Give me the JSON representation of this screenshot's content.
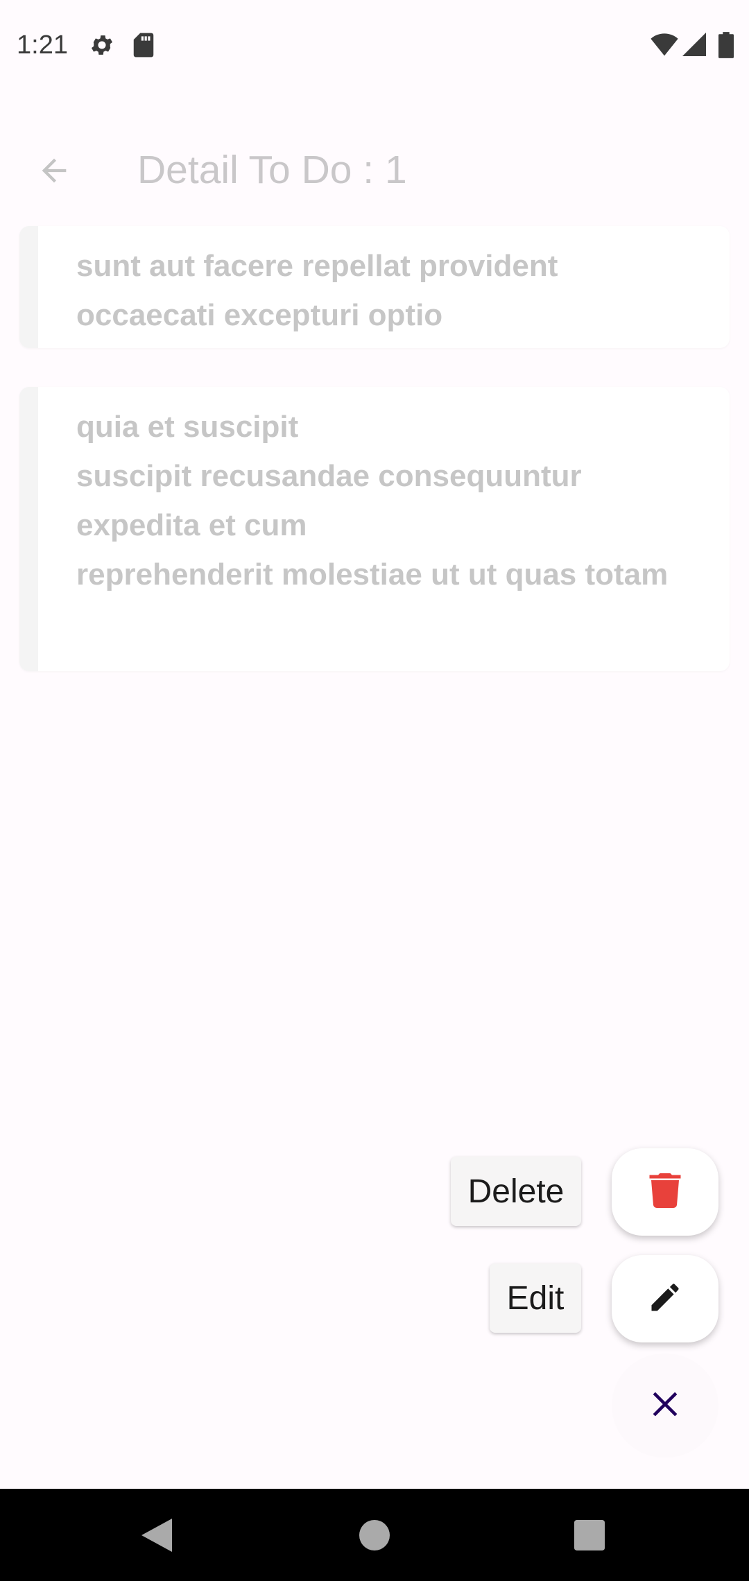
{
  "status_bar": {
    "time": "1:21",
    "left_icons": [
      "gear-icon",
      "sd-card-icon"
    ],
    "right_icons": [
      "wifi-icon",
      "signal-icon",
      "battery-icon"
    ]
  },
  "app_bar": {
    "title": "Detail To Do : 1",
    "back_icon": "arrow-back-icon"
  },
  "todo": {
    "title": "sunt aut facere repellat provident occaecati excepturi optio",
    "body": "quia et suscipit\nsuscipit recusandae consequuntur expedita et cum\nreprehenderit molestiae ut ut quas totam"
  },
  "speed_dial": {
    "delete_label": "Delete",
    "edit_label": "Edit",
    "delete_icon": "trash-icon",
    "edit_icon": "pencil-icon",
    "close_icon": "close-icon"
  },
  "colors": {
    "background": "#fffbfe",
    "delete_icon": "#e8413b",
    "close_icon": "#21005d",
    "muted_text": "#c6c6c6"
  },
  "nav_bar": {
    "buttons": [
      "back-triangle-icon",
      "home-circle-icon",
      "recents-square-icon"
    ]
  }
}
